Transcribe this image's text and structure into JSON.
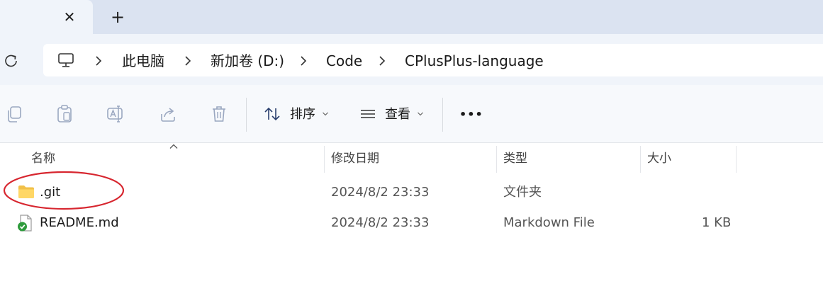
{
  "tabs": {
    "close_glyph": "✕",
    "add_glyph": "+"
  },
  "address": {
    "icon": "computer-icon",
    "separator": "chevron-right-icon",
    "crumbs": [
      "此电脑",
      "新加卷 (D:)",
      "Code",
      "CPlusPlus-language"
    ]
  },
  "toolbar": {
    "icons": [
      "copy-icon",
      "paste-icon",
      "rename-icon",
      "share-icon",
      "delete-icon"
    ],
    "sort_label": "排序",
    "view_label": "查看",
    "more_label": "•••"
  },
  "list": {
    "columns": {
      "name": "名称",
      "modified": "修改日期",
      "type": "类型",
      "size": "大小"
    },
    "rows": [
      {
        "name": ".git",
        "modified": "2024/8/2 23:33",
        "type": "文件夹",
        "size": "",
        "icon": "folder-icon"
      },
      {
        "name": "README.md",
        "modified": "2024/8/2 23:33",
        "type": "Markdown File",
        "size": "1 KB",
        "icon": "markdown-file-icon"
      }
    ]
  },
  "colors": {
    "tabstrip": "#dbe3f1",
    "navbar": "#f0f4fa",
    "folder": "#f5c84c",
    "annotation": "#d7262f",
    "check": "#2e9b3c"
  }
}
